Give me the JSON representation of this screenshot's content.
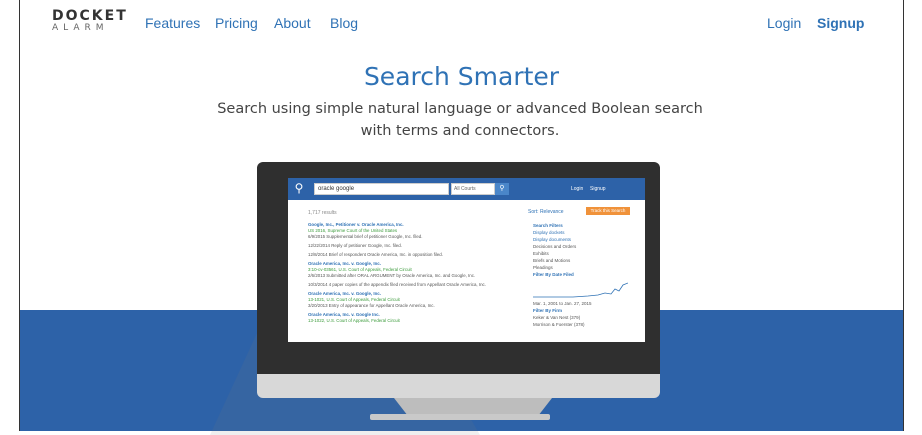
{
  "nav": {
    "logo_top": "DOCKET",
    "logo_bottom": "ALARM",
    "links": [
      "Features",
      "Pricing",
      "About",
      "Blog"
    ],
    "login": "Login",
    "signup": "Signup"
  },
  "hero": {
    "title": "Search Smarter",
    "subtitle_line1": "Search using simple natural language or advanced Boolean search",
    "subtitle_line2": "with terms and connectors."
  },
  "screen": {
    "search_value": "oracle google",
    "court_select": "All Courts",
    "login": "Login",
    "signup": "Signup",
    "result_count": "1,717 results",
    "sort_label": "Sort: Relevance",
    "track_button": "Track this Search",
    "results": [
      {
        "title": "Google, Inc., Petitioner v. Oracle America, Inc.",
        "court": "US 2016, Supreme Court of the United States",
        "text": "6/9/2015  Supplemental brief of petitioner Google, Inc. filed."
      },
      {
        "title": "",
        "court": "",
        "text": "12/22/2014  Reply of petitioner Google, Inc. filed."
      },
      {
        "title": "",
        "court": "",
        "text": "12/8/2014  Brief of respondent Oracle America, Inc. in opposition filed."
      },
      {
        "title": "Oracle America, Inc. v. Google, Inc.",
        "court": "3:10-cv-03561, U.S. Court of Appeals, Federal Circuit",
        "text": "2/6/2013  Submitted after ORAL ARGUMENT by Oracle America, Inc. and Google, Inc."
      },
      {
        "title": "",
        "court": "",
        "text": "10/3/2014  4 paper copies of the appendix filed received from Appellant Oracle America, Inc."
      },
      {
        "title": "Oracle America, Inc. v. Google, Inc.",
        "court": "13-1021, U.S. Court of Appeals, Federal Circuit",
        "text": "3/20/2013  Entry of appearance for Appellant Oracle America, Inc."
      },
      {
        "title": "Oracle America, Inc. v. Google Inc.",
        "court": "13-1022, U.S. Court of Appeals, Federal Circuit",
        "text": ""
      }
    ],
    "filters": {
      "heading": "Search Filters",
      "display_dockets": "Display dockets",
      "display_documents": "Display documents",
      "options": [
        "Decisions and Orders",
        "Exhibits",
        "Briefs and Motions",
        "Pleadings"
      ],
      "date_heading": "Filter By Date Filed",
      "date_range": "Mar. 1, 2001  to  Jan. 27, 2015",
      "firm_heading": "Filter By Firm",
      "firms": [
        "Keker & Van Nest (379)",
        "Morrison & Foerster (378)"
      ]
    }
  }
}
